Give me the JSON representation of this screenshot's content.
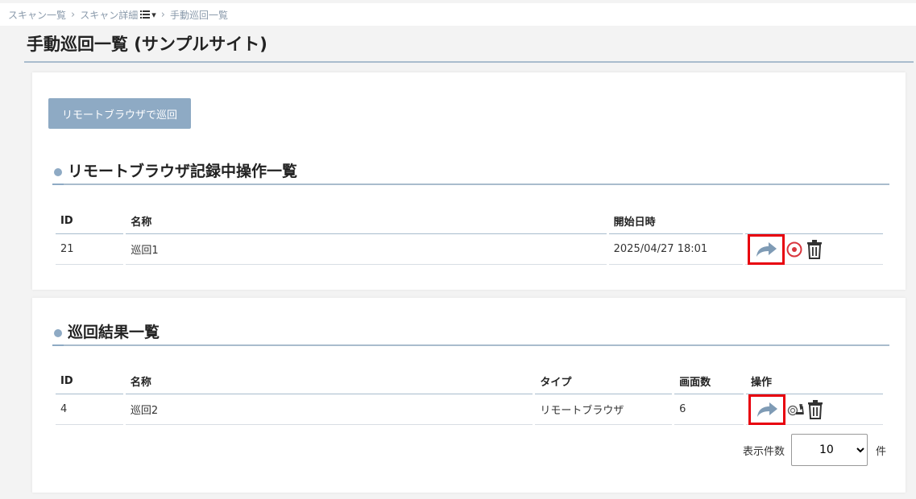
{
  "breadcrumb": {
    "item1": "スキャン一覧",
    "item2": "スキャン詳細",
    "item3": "手動巡回一覧"
  },
  "page_title": "手動巡回一覧 (サンプルサイト)",
  "remote_button_label": "リモートブラウザで巡回",
  "section1": {
    "title": "リモートブラウザ記録中操作一覧",
    "headers": [
      "ID",
      "名称",
      "開始日時",
      ""
    ],
    "rows": [
      {
        "id": "21",
        "name": "巡回1",
        "start": "2025/04/27 18:01"
      }
    ]
  },
  "section2": {
    "title": "巡回結果一覧",
    "headers": [
      "ID",
      "名称",
      "タイプ",
      "画面数",
      "操作"
    ],
    "rows": [
      {
        "id": "4",
        "name": "巡回2",
        "type": "リモートブラウザ",
        "screens": "6"
      }
    ]
  },
  "pagination": {
    "label": "表示件数",
    "value": "10",
    "unit": "件"
  },
  "colors": {
    "accent": "#8eaac4",
    "highlight": "#e8000d",
    "record": "#d9363e"
  },
  "icons": [
    "chevron-right-icon",
    "list-icon",
    "caret-down-icon",
    "share-arrow-icon",
    "record-icon",
    "trash-icon",
    "snail-icon"
  ]
}
